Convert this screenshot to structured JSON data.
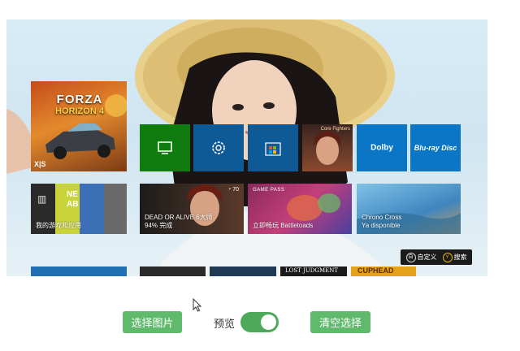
{
  "tiles": {
    "forza": {
      "title": "FORZA",
      "subtitle": "HORIZON 4",
      "corner": "X|S"
    },
    "dead_or_alive": {
      "title": "Core Fighters"
    },
    "dolby": {
      "label": "Dolby"
    },
    "bluray": {
      "label": "Blu-ray Disc"
    },
    "games_apps": {
      "label": "我的游戏和应用",
      "art": "NE AB"
    },
    "doa6": {
      "line1": "DEAD OR ALIVE 6大师",
      "line2": "94% 完成",
      "status": "70"
    },
    "battletoads": {
      "badge": "GAME PASS",
      "label": "立即畅玩 Battletoads"
    },
    "chrono": {
      "line1": "Chrono Cross",
      "line2": "Ya disponible"
    },
    "bottom_row": {
      "judgment": "LOST JUDGMENT",
      "cuphead": "CUPHEAD"
    }
  },
  "hints": {
    "customize_key": "自",
    "customize": "自定义",
    "search_key": "Y",
    "search": "搜索"
  },
  "controls": {
    "choose_image": "选择图片",
    "preview_label": "预览",
    "preview_enabled": true,
    "clear_selection": "清空选择"
  },
  "colors": {
    "xbox_green": "#107c10",
    "tile_blue": "#0e5a96",
    "button_green": "#5fba6b",
    "toggle_green": "#4caa5a"
  }
}
